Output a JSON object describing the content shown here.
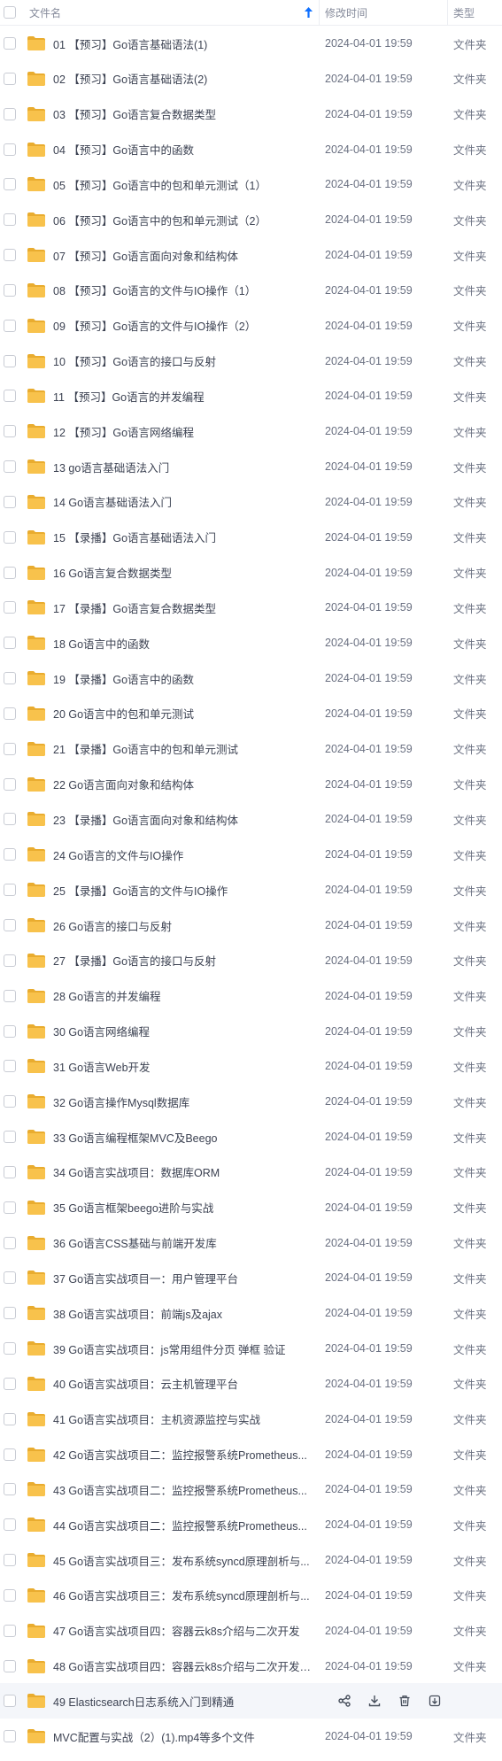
{
  "header": {
    "name": "文件名",
    "time": "修改时间",
    "type": "类型"
  },
  "colors": {
    "folder": "#f8c24c",
    "folder_tab": "#e9ac2f",
    "accent": "#0d6fff",
    "hover": "#f4f6fa"
  },
  "files": [
    {
      "name": "01 【预习】Go语言基础语法(1)",
      "time": "2024-04-01 19:59",
      "type": "文件夹"
    },
    {
      "name": "02 【预习】Go语言基础语法(2)",
      "time": "2024-04-01 19:59",
      "type": "文件夹"
    },
    {
      "name": "03 【预习】Go语言复合数据类型",
      "time": "2024-04-01 19:59",
      "type": "文件夹"
    },
    {
      "name": "04 【预习】Go语言中的函数",
      "time": "2024-04-01 19:59",
      "type": "文件夹"
    },
    {
      "name": "05 【预习】Go语言中的包和单元测试（1）",
      "time": "2024-04-01 19:59",
      "type": "文件夹"
    },
    {
      "name": "06 【预习】Go语言中的包和单元测试（2）",
      "time": "2024-04-01 19:59",
      "type": "文件夹"
    },
    {
      "name": "07 【预习】Go语言面向对象和结构体",
      "time": "2024-04-01 19:59",
      "type": "文件夹"
    },
    {
      "name": "08 【预习】Go语言的文件与IO操作（1）",
      "time": "2024-04-01 19:59",
      "type": "文件夹"
    },
    {
      "name": "09 【预习】Go语言的文件与IO操作（2）",
      "time": "2024-04-01 19:59",
      "type": "文件夹"
    },
    {
      "name": "10 【预习】Go语言的接口与反射",
      "time": "2024-04-01 19:59",
      "type": "文件夹"
    },
    {
      "name": "11 【预习】Go语言的并发编程",
      "time": "2024-04-01 19:59",
      "type": "文件夹"
    },
    {
      "name": "12 【预习】Go语言网络编程",
      "time": "2024-04-01 19:59",
      "type": "文件夹"
    },
    {
      "name": "13 go语言基础语法入门",
      "time": "2024-04-01 19:59",
      "type": "文件夹"
    },
    {
      "name": "14 Go语言基础语法入门",
      "time": "2024-04-01 19:59",
      "type": "文件夹"
    },
    {
      "name": "15 【录播】Go语言基础语法入门",
      "time": "2024-04-01 19:59",
      "type": "文件夹"
    },
    {
      "name": "16 Go语言复合数据类型",
      "time": "2024-04-01 19:59",
      "type": "文件夹"
    },
    {
      "name": "17 【录播】Go语言复合数据类型",
      "time": "2024-04-01 19:59",
      "type": "文件夹"
    },
    {
      "name": "18 Go语言中的函数",
      "time": "2024-04-01 19:59",
      "type": "文件夹"
    },
    {
      "name": "19 【录播】Go语言中的函数",
      "time": "2024-04-01 19:59",
      "type": "文件夹"
    },
    {
      "name": "20 Go语言中的包和单元测试",
      "time": "2024-04-01 19:59",
      "type": "文件夹"
    },
    {
      "name": "21 【录播】Go语言中的包和单元测试",
      "time": "2024-04-01 19:59",
      "type": "文件夹"
    },
    {
      "name": "22 Go语言面向对象和结构体",
      "time": "2024-04-01 19:59",
      "type": "文件夹"
    },
    {
      "name": "23 【录播】Go语言面向对象和结构体",
      "time": "2024-04-01 19:59",
      "type": "文件夹"
    },
    {
      "name": "24 Go语言的文件与IO操作",
      "time": "2024-04-01 19:59",
      "type": "文件夹"
    },
    {
      "name": "25 【录播】Go语言的文件与IO操作",
      "time": "2024-04-01 19:59",
      "type": "文件夹"
    },
    {
      "name": "26 Go语言的接口与反射",
      "time": "2024-04-01 19:59",
      "type": "文件夹"
    },
    {
      "name": "27 【录播】Go语言的接口与反射",
      "time": "2024-04-01 19:59",
      "type": "文件夹"
    },
    {
      "name": "28 Go语言的并发编程",
      "time": "2024-04-01 19:59",
      "type": "文件夹"
    },
    {
      "name": "30 Go语言网络编程",
      "time": "2024-04-01 19:59",
      "type": "文件夹"
    },
    {
      "name": "31 Go语言Web开发",
      "time": "2024-04-01 19:59",
      "type": "文件夹"
    },
    {
      "name": "32 Go语言操作Mysql数据库",
      "time": "2024-04-01 19:59",
      "type": "文件夹"
    },
    {
      "name": "33 Go语言编程框架MVC及Beego",
      "time": "2024-04-01 19:59",
      "type": "文件夹"
    },
    {
      "name": "34 Go语言实战项目：数据库ORM",
      "time": "2024-04-01 19:59",
      "type": "文件夹"
    },
    {
      "name": "35 Go语言框架beego进阶与实战",
      "time": "2024-04-01 19:59",
      "type": "文件夹"
    },
    {
      "name": "36 Go语言CSS基础与前端开发库",
      "time": "2024-04-01 19:59",
      "type": "文件夹"
    },
    {
      "name": "37 Go语言实战项目一：用户管理平台",
      "time": "2024-04-01 19:59",
      "type": "文件夹"
    },
    {
      "name": "38 Go语言实战项目：前端js及ajax",
      "time": "2024-04-01 19:59",
      "type": "文件夹"
    },
    {
      "name": "39 Go语言实战项目：js常用组件分页  弹框  验证",
      "time": "2024-04-01 19:59",
      "type": "文件夹"
    },
    {
      "name": "40 Go语言实战项目：云主机管理平台",
      "time": "2024-04-01 19:59",
      "type": "文件夹"
    },
    {
      "name": "41 Go语言实战项目：主机资源监控与实战",
      "time": "2024-04-01 19:59",
      "type": "文件夹"
    },
    {
      "name": "42 Go语言实战项目二：监控报警系统Prometheus...",
      "time": "2024-04-01 19:59",
      "type": "文件夹"
    },
    {
      "name": "43 Go语言实战项目二：监控报警系统Prometheus...",
      "time": "2024-04-01 19:59",
      "type": "文件夹"
    },
    {
      "name": "44 Go语言实战项目二：监控报警系统Prometheus...",
      "time": "2024-04-01 19:59",
      "type": "文件夹"
    },
    {
      "name": "45 Go语言实战项目三：发布系统syncd原理剖析与...",
      "time": "2024-04-01 19:59",
      "type": "文件夹"
    },
    {
      "name": "46 Go语言实战项目三：发布系统syncd原理剖析与...",
      "time": "2024-04-01 19:59",
      "type": "文件夹"
    },
    {
      "name": "47 Go语言实战项目四：容器云k8s介绍与二次开发",
      "time": "2024-04-01 19:59",
      "type": "文件夹"
    },
    {
      "name": "48 Go语言实战项目四：容器云k8s介绍与二次开发（...",
      "time": "2024-04-01 19:59",
      "type": "文件夹"
    },
    {
      "name": "49 Elasticsearch日志系统入门到精通",
      "time": "",
      "type": "",
      "hover": true
    },
    {
      "name": "MVC配置与实战（2）(1).mp4等多个文件",
      "time": "2024-04-01 19:59",
      "type": "文件夹"
    }
  ]
}
